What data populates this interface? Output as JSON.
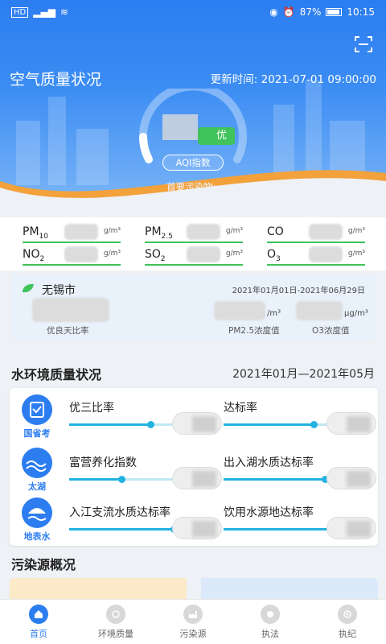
{
  "statusbar": {
    "battery": "87%",
    "time": "10:15",
    "network": "HD"
  },
  "header": {
    "title": "空气质量状况",
    "update_time": "更新时间: 2021-07-01 09:00:00",
    "aqi_label": "AQI指数",
    "level_text": "优",
    "primary_pollutant": "首要污染物:-"
  },
  "pollutants": [
    {
      "name": "PM",
      "sub": "10",
      "unit": "g/m³"
    },
    {
      "name": "PM",
      "sub": "2.5",
      "unit": "g/m³"
    },
    {
      "name": "CO",
      "sub": "",
      "unit": "g/m³"
    },
    {
      "name": "NO",
      "sub": "2",
      "unit": "g/m³"
    },
    {
      "name": "SO",
      "sub": "2",
      "unit": "g/m³"
    },
    {
      "name": "O",
      "sub": "3",
      "unit": "g/m³"
    }
  ],
  "city_card": {
    "city": "无锡市",
    "range": "2021年01月01日-2021年06月29日",
    "label_good_ratio": "优良天比率",
    "label_pm25": "PM2.5浓度值",
    "label_o3": "O3浓度值",
    "unit_pm25": "/m³",
    "unit_o3": "μg/m³"
  },
  "water": {
    "title": "水环境质量状况",
    "range": "2021年01月—2021年05月",
    "groups": [
      {
        "icon_caption": "国省考",
        "metrics": [
          {
            "label": "优三比率"
          },
          {
            "label": "达标率"
          }
        ]
      },
      {
        "icon_caption": "太湖",
        "metrics": [
          {
            "label": "富营养化指数"
          },
          {
            "label": "出入湖水质达标率"
          }
        ]
      },
      {
        "icon_caption": "地表水",
        "metrics": [
          {
            "label": "入江支流水质达标率"
          },
          {
            "label": "饮用水源地达标率"
          }
        ]
      }
    ]
  },
  "pollution_sources": {
    "title": "污染源概况"
  },
  "tabbar": {
    "tabs": [
      {
        "label": "首页"
      },
      {
        "label": "环境质量"
      },
      {
        "label": "污染源"
      },
      {
        "label": "执法"
      },
      {
        "label": "执纪"
      }
    ]
  },
  "colors": {
    "primary": "#2c7df0",
    "good_green": "#3fc35a",
    "water_cyan": "#22b3e0"
  }
}
